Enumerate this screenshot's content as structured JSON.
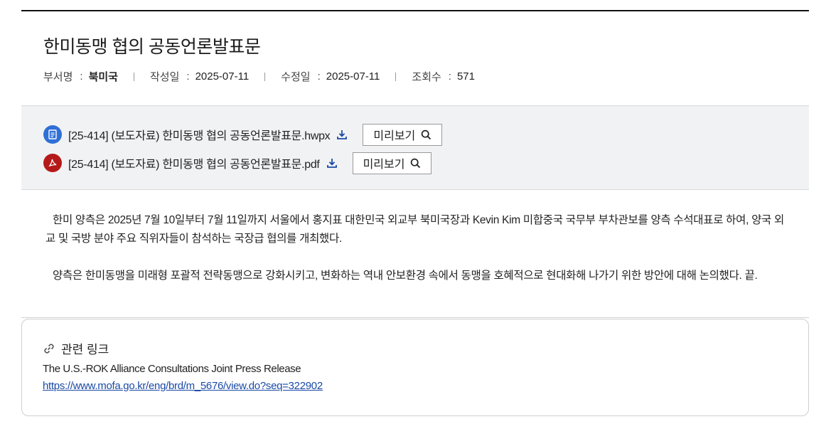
{
  "article": {
    "title": "한미동맹 협의 공동언론발표문",
    "meta": {
      "dept_label": "부서명",
      "dept_value": "북미국",
      "created_label": "작성일",
      "created_value": "2025-07-11",
      "modified_label": "수정일",
      "modified_value": "2025-07-11",
      "views_label": "조회수",
      "views_value": "571",
      "colon": ":"
    },
    "attachments": [
      {
        "icon": "hwp-file-icon",
        "name": "[25-414] (보도자료) 한미동맹 협의 공동언론발표문.hwpx",
        "preview_label": "미리보기"
      },
      {
        "icon": "pdf-file-icon",
        "name": "[25-414] (보도자료) 한미동맹 협의 공동언론발표문.pdf",
        "preview_label": "미리보기"
      }
    ],
    "body": [
      "한미 양측은 2025년 7월 10일부터 7월 11일까지 서울에서 홍지표 대한민국 외교부 북미국장과 Kevin Kim 미합중국 국무부 부차관보를 양측 수석대표로 하여, 양국 외교 및 국방 분야 주요 직위자들이 참석하는 국장급 협의를 개최했다.",
      "양측은 한미동맹을 미래형 포괄적 전략동맹으로 강화시키고, 변화하는 역내 안보환경 속에서 동맹을 호혜적으로 현대화해 나가기 위한 방안에 대해 논의했다.  끝."
    ],
    "related_links": {
      "heading": "관련 링크",
      "description": "The U.S.-ROK Alliance Consultations Joint Press Release",
      "url": "https://www.mofa.go.kr/eng/brd/m_5676/view.do?seq=322902"
    }
  },
  "colors": {
    "hwp_icon": "#2f6fd6",
    "pdf_icon": "#b51a1a",
    "download_icon": "#1b4aa6",
    "link": "#1b4aa6"
  }
}
